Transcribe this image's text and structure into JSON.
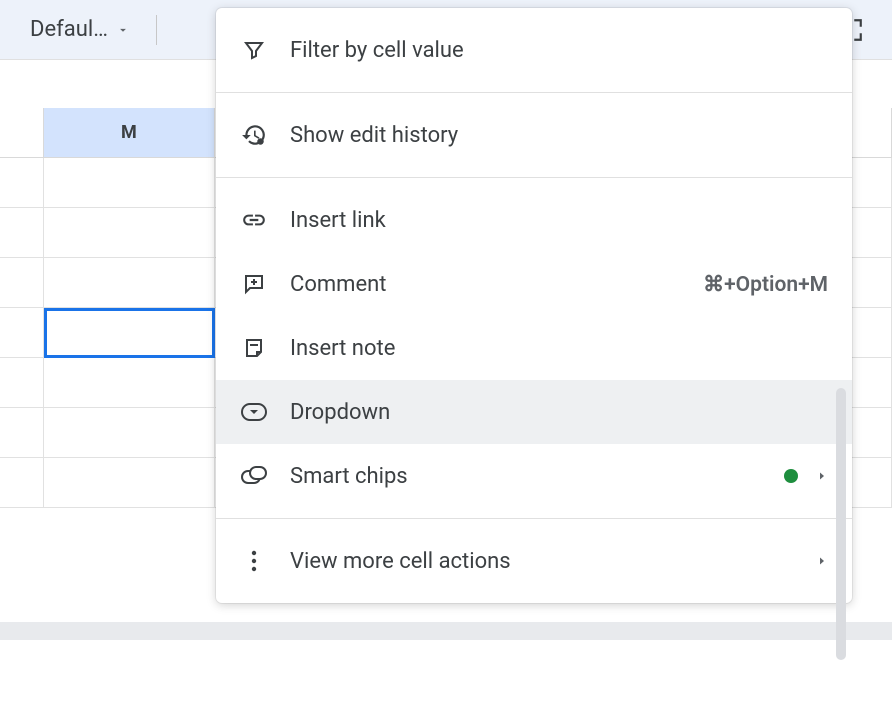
{
  "toolbar": {
    "font_label": "Defaul…"
  },
  "columns": {
    "selected": "M"
  },
  "menu": {
    "filter_label": "Filter by cell value",
    "history_label": "Show edit history",
    "link_label": "Insert link",
    "comment_label": "Comment",
    "comment_shortcut": "⌘+Option+M",
    "note_label": "Insert note",
    "dropdown_label": "Dropdown",
    "smartchips_label": "Smart chips",
    "more_label": "View more cell actions"
  }
}
